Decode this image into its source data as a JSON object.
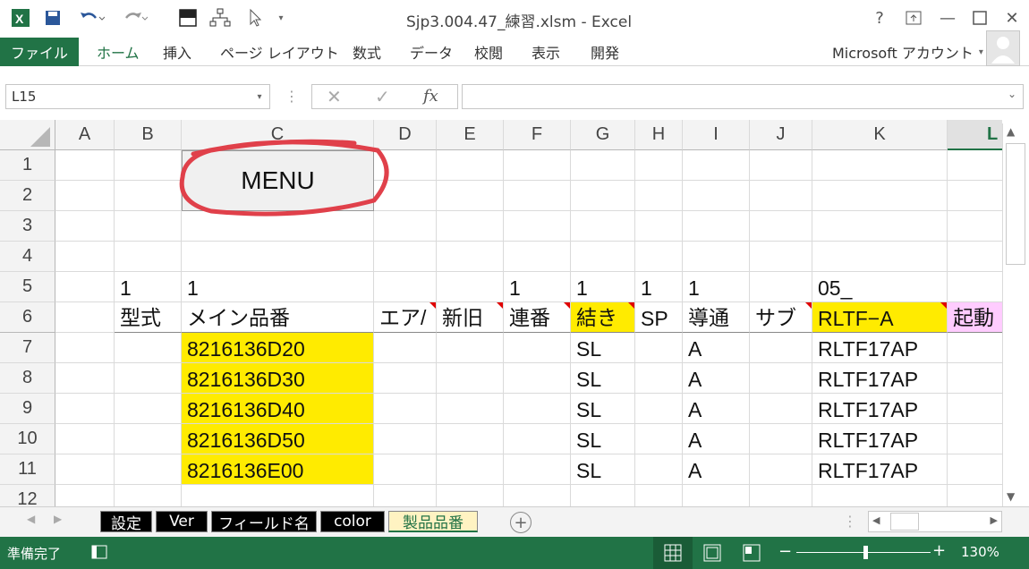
{
  "window": {
    "title": "Sjp3.004.47_練習.xlsm - Excel",
    "help": "?",
    "minimize": "—",
    "close": "✕"
  },
  "ribbon": {
    "file": "ファイル",
    "tabs": [
      "ホーム",
      "挿入",
      "ページ レイアウト",
      "数式",
      "データ",
      "校閲",
      "表示",
      "開発"
    ],
    "account": "Microsoft アカウント"
  },
  "formula_bar": {
    "name_box": "L15",
    "fx": "fx",
    "formula": ""
  },
  "columns": [
    "A",
    "B",
    "C",
    "D",
    "E",
    "F",
    "G",
    "H",
    "I",
    "J",
    "K",
    "L"
  ],
  "rows": [
    "1",
    "2",
    "3",
    "4",
    "5",
    "6",
    "7",
    "8",
    "9",
    "10",
    "11",
    "12"
  ],
  "menu_button": "MENU",
  "cells": {
    "r5": {
      "B": "1",
      "C": "1",
      "F": "1",
      "G": "1",
      "H": "1",
      "I": "1",
      "K": "05_"
    },
    "r6": {
      "B": "型式",
      "C": "メイン品番",
      "D": "エア/",
      "E": "新旧",
      "F": "連番",
      "G": "結き",
      "H": "SP",
      "I": "導通",
      "J": "サブ",
      "K": "RLTF−A",
      "L": "起動"
    },
    "data_rows": [
      {
        "C": "8216136D20",
        "G": "SL",
        "I": "A",
        "K": "RLTF17AP"
      },
      {
        "C": "8216136D30",
        "G": "SL",
        "I": "A",
        "K": "RLTF17AP"
      },
      {
        "C": "8216136D40",
        "G": "SL",
        "I": "A",
        "K": "RLTF17AP"
      },
      {
        "C": "8216136D50",
        "G": "SL",
        "I": "A",
        "K": "RLTF17AP"
      },
      {
        "C": "8216136E00",
        "G": "SL",
        "I": "A",
        "K": "RLTF17AP"
      }
    ]
  },
  "sheets": [
    "設定",
    "Ver",
    "フィールド名",
    "color",
    "製品品番"
  ],
  "active_sheet": "製品品番",
  "status": {
    "ready": "準備完了",
    "zoom": "130%"
  },
  "colors": {
    "excel_green": "#217346",
    "highlight_yellow": "#ffeb00",
    "highlight_pink": "#ffccff",
    "annotation_red": "#e0404a"
  }
}
